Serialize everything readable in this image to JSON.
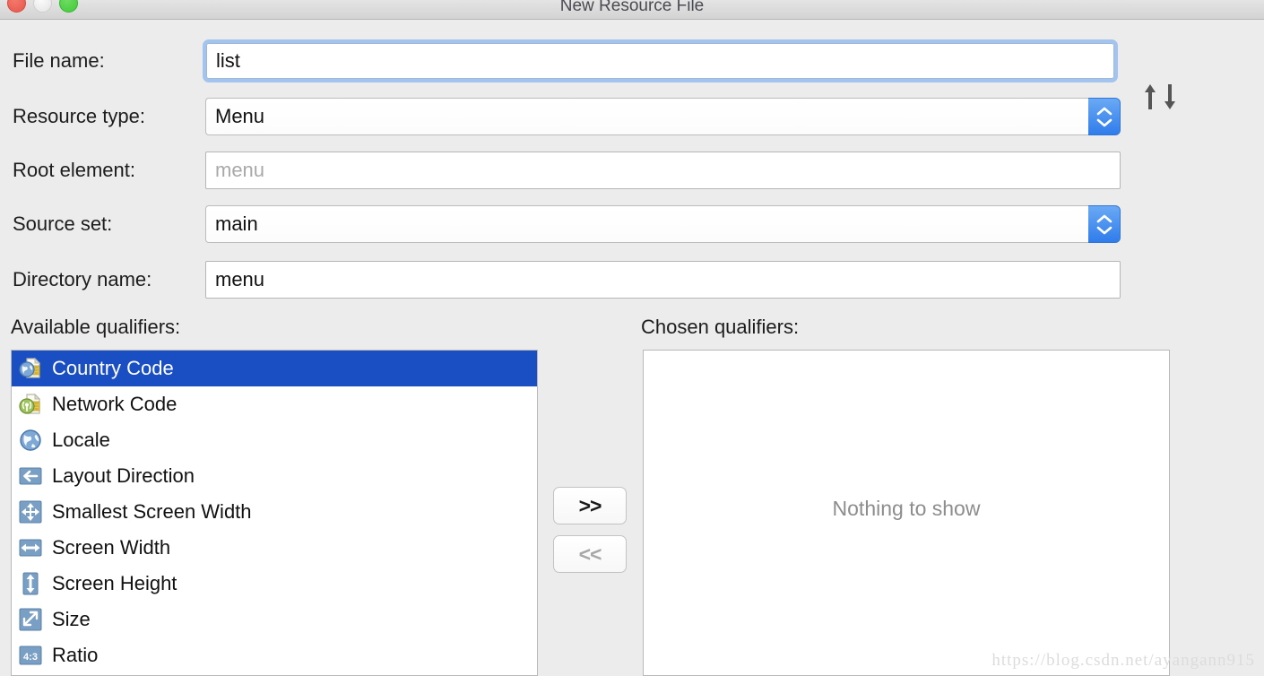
{
  "window": {
    "title": "New Resource File",
    "controls": [
      {
        "name": "close",
        "color": "#e8554a"
      },
      {
        "name": "minimize",
        "color": "#e3e3e3"
      },
      {
        "name": "zoom",
        "color": "#41c93a"
      }
    ]
  },
  "form": {
    "fields": [
      {
        "label": "File name:",
        "type": "text",
        "value": "list",
        "placeholder": "",
        "focused": true
      },
      {
        "label": "Resource type:",
        "type": "combo",
        "value": "Menu",
        "placeholder": ""
      },
      {
        "label": "Root element:",
        "type": "text",
        "value": "",
        "placeholder": "menu",
        "readonly": true
      },
      {
        "label": "Source set:",
        "type": "combo",
        "value": "main",
        "placeholder": ""
      },
      {
        "label": "Directory name:",
        "type": "text",
        "value": "menu",
        "placeholder": ""
      }
    ],
    "sort_icon": "up-down-arrows-icon"
  },
  "qualifiers": {
    "available_label": "Available qualifiers:",
    "chosen_label": "Chosen qualifiers:",
    "available": [
      {
        "label": "Country Code",
        "icon": "country-code-icon",
        "selected": true
      },
      {
        "label": "Network Code",
        "icon": "network-code-icon",
        "selected": false
      },
      {
        "label": "Locale",
        "icon": "locale-globe-icon",
        "selected": false
      },
      {
        "label": "Layout Direction",
        "icon": "layout-direction-icon",
        "selected": false
      },
      {
        "label": "Smallest Screen Width",
        "icon": "smallest-screen-width-icon",
        "selected": false
      },
      {
        "label": "Screen Width",
        "icon": "screen-width-icon",
        "selected": false
      },
      {
        "label": "Screen Height",
        "icon": "screen-height-icon",
        "selected": false
      },
      {
        "label": "Size",
        "icon": "size-icon",
        "selected": false
      },
      {
        "label": "Ratio",
        "icon": "ratio-icon",
        "selected": false
      }
    ],
    "chosen": [],
    "chosen_empty_text": "Nothing to show",
    "add_button": ">>",
    "remove_button": "<<"
  },
  "watermark": "https://blog.csdn.net/ayangann915",
  "colors": {
    "selection_blue": "#1a4fc4",
    "focus_ring": "#a3c4ef",
    "stepper_blue": "#2f7ceb",
    "window_bg": "#ececec"
  }
}
